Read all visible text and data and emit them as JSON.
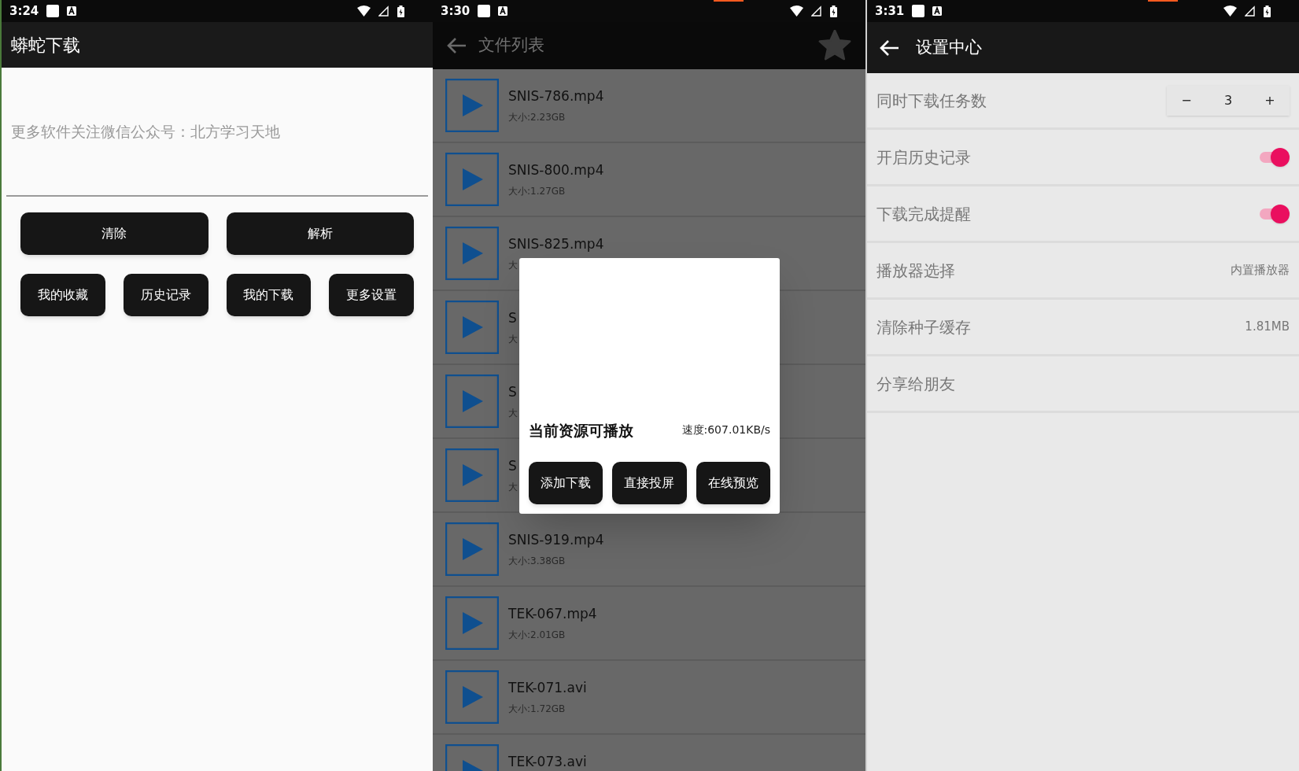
{
  "home": {
    "status_bar": {
      "time": "3:24"
    },
    "title": "蟒蛇下载",
    "link_field": {
      "placeholder": "更多软件关注微信公众号：北方学习天地"
    },
    "primary_buttons": [
      "清除",
      "解析"
    ],
    "nav_buttons": [
      "我的收藏",
      "历史记录",
      "我的下载",
      "更多设置"
    ]
  },
  "file_list": {
    "status_bar": {
      "time": "3:30"
    },
    "title": "文件列表",
    "files": [
      {
        "name": "SNIS-786.mp4",
        "size": "大小:2.23GB"
      },
      {
        "name": "SNIS-800.mp4",
        "size": "大小:1.27GB"
      },
      {
        "name": "SNIS-825.mp4",
        "size": "大"
      },
      {
        "name": "S",
        "size": "大"
      },
      {
        "name": "S",
        "size": "大"
      },
      {
        "name": "S",
        "size": "大"
      },
      {
        "name": "SNIS-919.mp4",
        "size": "大小:3.38GB"
      },
      {
        "name": "TEK-067.mp4",
        "size": "大小:2.01GB"
      },
      {
        "name": "TEK-071.avi",
        "size": "大小:1.72GB"
      },
      {
        "name": "TEK-073.avi"
      }
    ],
    "dialog": {
      "title": "当前资源可播放",
      "speed": "速度:607.01KB/s",
      "buttons": [
        "添加下载",
        "直接投屏",
        "在线预览"
      ]
    }
  },
  "settings": {
    "status_bar": {
      "time": "3:31"
    },
    "title": "设置中心",
    "rows": [
      {
        "kind": "stepper",
        "label": "同时下载任务数",
        "minus": "−",
        "value": "3",
        "plus": "+"
      },
      {
        "kind": "toggle",
        "label": "开启历史记录",
        "on": true
      },
      {
        "kind": "toggle",
        "label": "下载完成提醒",
        "on": true
      },
      {
        "kind": "value",
        "label": "播放器选择",
        "value": "内置播放器"
      },
      {
        "kind": "value",
        "label": "清除种子缓存",
        "value": "1.81MB"
      },
      {
        "kind": "plain",
        "label": "分享给朋友"
      }
    ]
  }
}
